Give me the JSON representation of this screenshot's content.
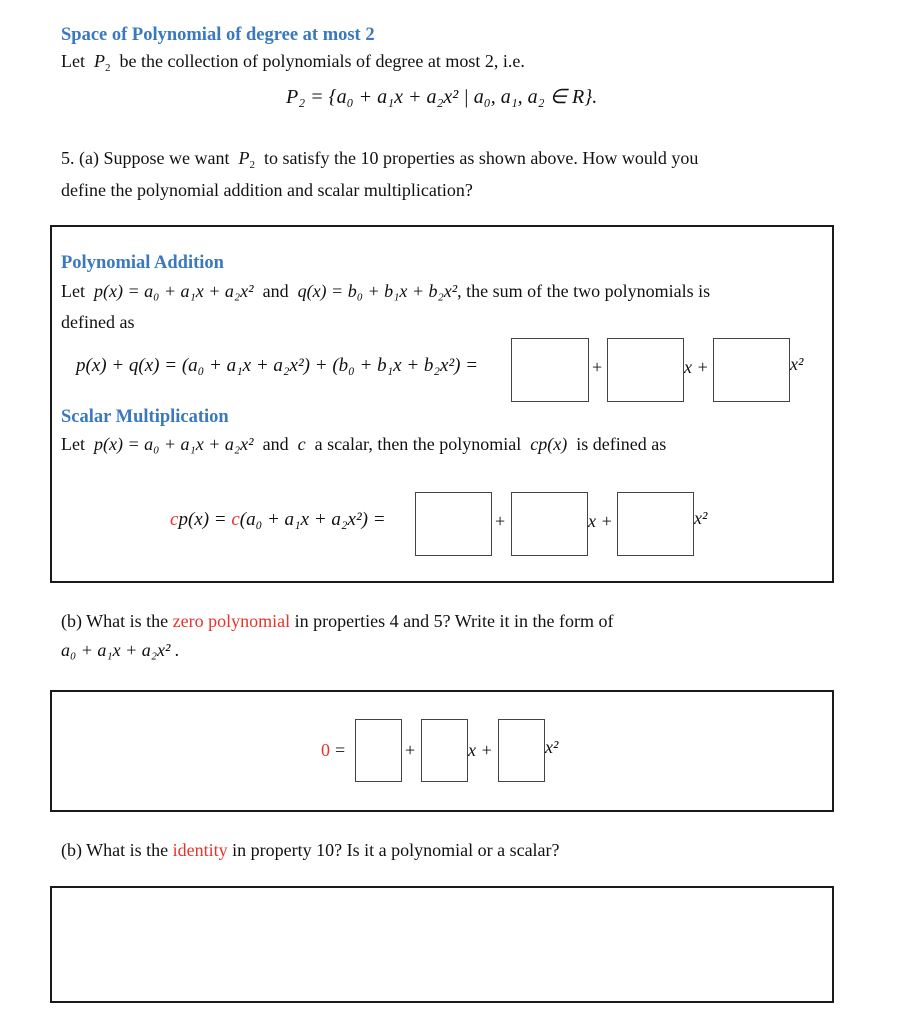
{
  "header": {
    "title": "Space of Polynomial of degree at most 2",
    "intro_prefix": "Let",
    "intro_suffix": "be the collection of polynomials of degree at most 2, i.e.",
    "set_def": "P₂ = {a₀ + a₁x + a₂x² | a₀, a₁, a₂ ∈ R}."
  },
  "question_a": {
    "line1_prefix": "5. (a) Suppose we want",
    "line1_suffix": "to satisfy the 10 properties as shown above.   How would you",
    "line2": "define the polynomial addition and scalar multiplication?"
  },
  "addition": {
    "heading": "Polynomial Addition",
    "line1_prefix": "Let",
    "p_def": "p(x) = a₀ + a₁x + a₂x²",
    "and": "and",
    "q_def": "q(x) = b₀ + b₁x + b₂x²",
    "line1_suffix": ", the sum of the two polynomials is",
    "line2": "defined as",
    "equation": "p(x) + q(x) = (a₀ + a₁x + a₂x²) + (b₀ + b₁x + b₂x²) =",
    "terms": [
      "+",
      "x +",
      "x²"
    ],
    "answers": [
      "",
      "",
      ""
    ]
  },
  "scalar": {
    "heading": "Scalar Multiplication",
    "line1_prefix": "Let",
    "p_def": "p(x) = a₀ + a₁x + a₂x²",
    "line1_mid": "and",
    "c": "c",
    "line1_mid2": "a scalar, then the polynomial",
    "cp": "cp(x)",
    "line1_suffix": "is defined as",
    "eq_c1": "c",
    "eq_rest1": "p(x) = ",
    "eq_c2": "c",
    "eq_rest2": "(a₀ + a₁x + a₂x²) =",
    "terms": [
      "+",
      "x +",
      "x²"
    ],
    "answers": [
      "",
      "",
      ""
    ]
  },
  "question_b1": {
    "prefix": "(b) What is the",
    "highlight": "zero polynomial",
    "suffix": "in properties 4 and 5?   Write it in the form of",
    "form": "a₀ + a₁x + a₂x² .",
    "zero": "0",
    "equals": "=",
    "terms": [
      "+",
      "x +",
      "x²"
    ],
    "answers": [
      "",
      "",
      ""
    ]
  },
  "question_b2": {
    "prefix": "(b) What is the",
    "highlight": "identity",
    "suffix": "in property 10?   Is it a polynomial or a scalar?",
    "answer": ""
  },
  "colors": {
    "heading_blue": "#3a78c0",
    "highlight_red": "#e8322a"
  }
}
